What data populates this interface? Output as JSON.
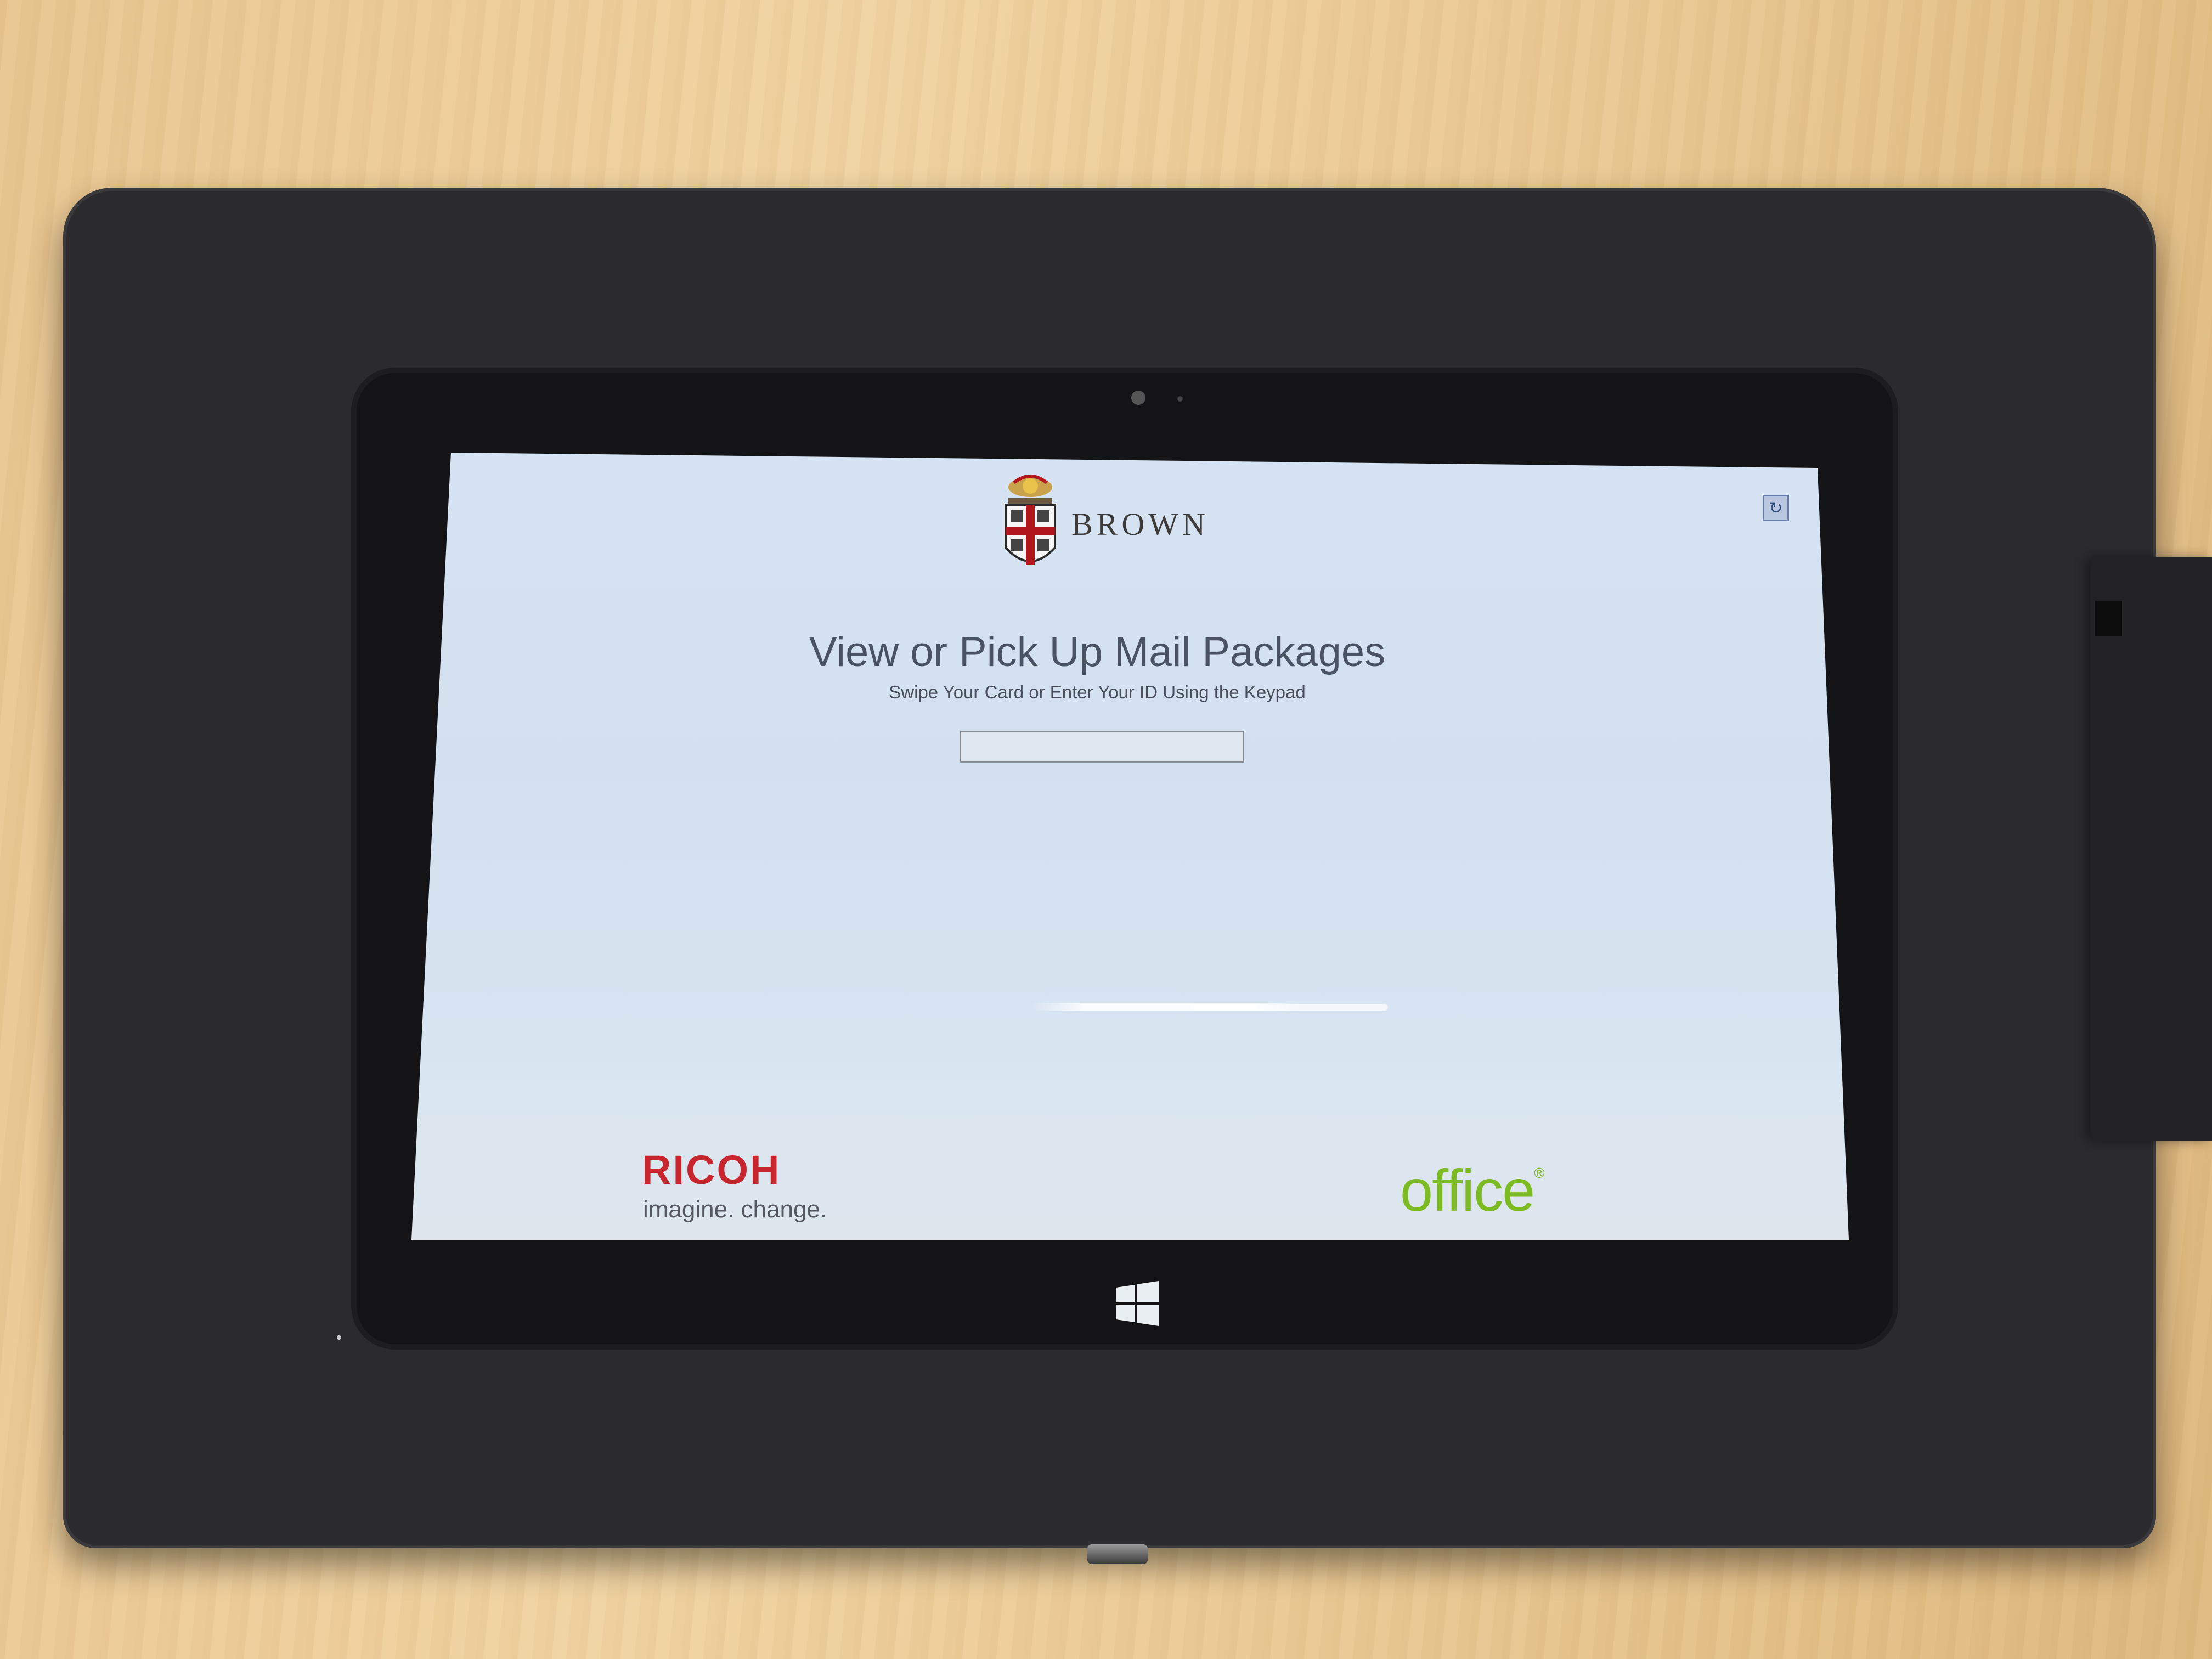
{
  "header": {
    "logo_text": "BROWN"
  },
  "main": {
    "title": "View or Pick Up Mail Packages",
    "subtitle": "Swipe Your Card or Enter Your ID Using the Keypad",
    "id_input_value": "",
    "id_input_placeholder": ""
  },
  "footer": {
    "ricoh_logo": "RICOH",
    "ricoh_tagline": "imagine. change.",
    "iofi_logo_text": "office",
    "iofi_reg_mark": "®"
  },
  "icons": {
    "refresh": "refresh-icon",
    "windows": "windows-logo-icon",
    "shield": "brown-shield-icon"
  },
  "colors": {
    "screen_bg": "#d6e3f2",
    "title_text": "#4a5362",
    "ricoh_red": "#c8262f",
    "iofi_green": "#7cbb22",
    "brown_cross": "#b0161c"
  }
}
